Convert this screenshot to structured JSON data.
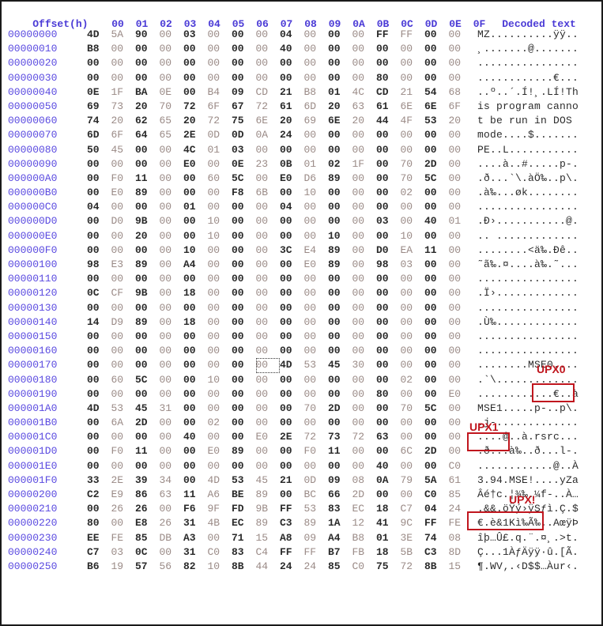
{
  "header": {
    "offset_label": "Offset(h)",
    "columns": [
      "00",
      "01",
      "02",
      "03",
      "04",
      "05",
      "06",
      "07",
      "08",
      "09",
      "0A",
      "0B",
      "0C",
      "0D",
      "0E",
      "0F"
    ],
    "decoded_label": "Decoded text"
  },
  "selected_cell": {
    "row": "00000170",
    "col": "07"
  },
  "rows": [
    {
      "offset": "00000000",
      "bytes": [
        "4D",
        "5A",
        "90",
        "00",
        "03",
        "00",
        "00",
        "00",
        "04",
        "00",
        "00",
        "00",
        "FF",
        "FF",
        "00",
        "00"
      ],
      "text": "MZ..........ÿÿ.."
    },
    {
      "offset": "00000010",
      "bytes": [
        "B8",
        "00",
        "00",
        "00",
        "00",
        "00",
        "00",
        "00",
        "40",
        "00",
        "00",
        "00",
        "00",
        "00",
        "00",
        "00"
      ],
      "text": "¸.......@......."
    },
    {
      "offset": "00000020",
      "bytes": [
        "00",
        "00",
        "00",
        "00",
        "00",
        "00",
        "00",
        "00",
        "00",
        "00",
        "00",
        "00",
        "00",
        "00",
        "00",
        "00"
      ],
      "text": "................"
    },
    {
      "offset": "00000030",
      "bytes": [
        "00",
        "00",
        "00",
        "00",
        "00",
        "00",
        "00",
        "00",
        "00",
        "00",
        "00",
        "00",
        "80",
        "00",
        "00",
        "00"
      ],
      "text": "............€..."
    },
    {
      "offset": "00000040",
      "bytes": [
        "0E",
        "1F",
        "BA",
        "0E",
        "00",
        "B4",
        "09",
        "CD",
        "21",
        "B8",
        "01",
        "4C",
        "CD",
        "21",
        "54",
        "68"
      ],
      "text": "..º..´.Í!¸.LÍ!Th"
    },
    {
      "offset": "00000050",
      "bytes": [
        "69",
        "73",
        "20",
        "70",
        "72",
        "6F",
        "67",
        "72",
        "61",
        "6D",
        "20",
        "63",
        "61",
        "6E",
        "6E",
        "6F"
      ],
      "text": "is program canno"
    },
    {
      "offset": "00000060",
      "bytes": [
        "74",
        "20",
        "62",
        "65",
        "20",
        "72",
        "75",
        "6E",
        "20",
        "69",
        "6E",
        "20",
        "44",
        "4F",
        "53",
        "20"
      ],
      "text": "t be run in DOS "
    },
    {
      "offset": "00000070",
      "bytes": [
        "6D",
        "6F",
        "64",
        "65",
        "2E",
        "0D",
        "0D",
        "0A",
        "24",
        "00",
        "00",
        "00",
        "00",
        "00",
        "00",
        "00"
      ],
      "text": "mode....$......."
    },
    {
      "offset": "00000080",
      "bytes": [
        "50",
        "45",
        "00",
        "00",
        "4C",
        "01",
        "03",
        "00",
        "00",
        "00",
        "00",
        "00",
        "00",
        "00",
        "00",
        "00"
      ],
      "text": "PE..L..........."
    },
    {
      "offset": "00000090",
      "bytes": [
        "00",
        "00",
        "00",
        "00",
        "E0",
        "00",
        "0E",
        "23",
        "0B",
        "01",
        "02",
        "1F",
        "00",
        "70",
        "2D",
        "00"
      ],
      "text": "....à..#.....p-."
    },
    {
      "offset": "000000A0",
      "bytes": [
        "00",
        "F0",
        "11",
        "00",
        "00",
        "60",
        "5C",
        "00",
        "E0",
        "D6",
        "89",
        "00",
        "00",
        "70",
        "5C",
        "00"
      ],
      "text": ".ð...`\\.àÖ‰..p\\."
    },
    {
      "offset": "000000B0",
      "bytes": [
        "00",
        "E0",
        "89",
        "00",
        "00",
        "00",
        "F8",
        "6B",
        "00",
        "10",
        "00",
        "00",
        "00",
        "02",
        "00",
        "00"
      ],
      "text": ".à‰...øk........"
    },
    {
      "offset": "000000C0",
      "bytes": [
        "04",
        "00",
        "00",
        "00",
        "01",
        "00",
        "00",
        "00",
        "04",
        "00",
        "00",
        "00",
        "00",
        "00",
        "00",
        "00"
      ],
      "text": "................"
    },
    {
      "offset": "000000D0",
      "bytes": [
        "00",
        "D0",
        "9B",
        "00",
        "00",
        "10",
        "00",
        "00",
        "00",
        "00",
        "00",
        "00",
        "03",
        "00",
        "40",
        "01"
      ],
      "text": ".Ð›...........@."
    },
    {
      "offset": "000000E0",
      "bytes": [
        "00",
        "00",
        "20",
        "00",
        "00",
        "10",
        "00",
        "00",
        "00",
        "00",
        "10",
        "00",
        "00",
        "10",
        "00",
        "00"
      ],
      "text": ".. ............."
    },
    {
      "offset": "000000F0",
      "bytes": [
        "00",
        "00",
        "00",
        "00",
        "10",
        "00",
        "00",
        "00",
        "3C",
        "E4",
        "89",
        "00",
        "D0",
        "EA",
        "11",
        "00"
      ],
      "text": "........<ä‰.Ðê.."
    },
    {
      "offset": "00000100",
      "bytes": [
        "98",
        "E3",
        "89",
        "00",
        "A4",
        "00",
        "00",
        "00",
        "00",
        "E0",
        "89",
        "00",
        "98",
        "03",
        "00",
        "00"
      ],
      "text": "˜ã‰.¤....à‰.˜..."
    },
    {
      "offset": "00000110",
      "bytes": [
        "00",
        "00",
        "00",
        "00",
        "00",
        "00",
        "00",
        "00",
        "00",
        "00",
        "00",
        "00",
        "00",
        "00",
        "00",
        "00"
      ],
      "text": "................"
    },
    {
      "offset": "00000120",
      "bytes": [
        "0C",
        "CF",
        "9B",
        "00",
        "18",
        "00",
        "00",
        "00",
        "00",
        "00",
        "00",
        "00",
        "00",
        "00",
        "00",
        "00"
      ],
      "text": ".Ï›............."
    },
    {
      "offset": "00000130",
      "bytes": [
        "00",
        "00",
        "00",
        "00",
        "00",
        "00",
        "00",
        "00",
        "00",
        "00",
        "00",
        "00",
        "00",
        "00",
        "00",
        "00"
      ],
      "text": "................"
    },
    {
      "offset": "00000140",
      "bytes": [
        "14",
        "D9",
        "89",
        "00",
        "18",
        "00",
        "00",
        "00",
        "00",
        "00",
        "00",
        "00",
        "00",
        "00",
        "00",
        "00"
      ],
      "text": ".Ù‰............."
    },
    {
      "offset": "00000150",
      "bytes": [
        "00",
        "00",
        "00",
        "00",
        "00",
        "00",
        "00",
        "00",
        "00",
        "00",
        "00",
        "00",
        "00",
        "00",
        "00",
        "00"
      ],
      "text": "................"
    },
    {
      "offset": "00000160",
      "bytes": [
        "00",
        "00",
        "00",
        "00",
        "00",
        "00",
        "00",
        "00",
        "00",
        "00",
        "00",
        "00",
        "00",
        "00",
        "00",
        "00"
      ],
      "text": "................"
    },
    {
      "offset": "00000170",
      "bytes": [
        "00",
        "00",
        "00",
        "00",
        "00",
        "00",
        "00",
        "00",
        "4D",
        "53",
        "45",
        "30",
        "00",
        "00",
        "00",
        "00"
      ],
      "text": "........MSE0...."
    },
    {
      "offset": "00000180",
      "bytes": [
        "00",
        "60",
        "5C",
        "00",
        "00",
        "10",
        "00",
        "00",
        "00",
        "00",
        "00",
        "00",
        "00",
        "02",
        "00",
        "00"
      ],
      "text": ".`\\............."
    },
    {
      "offset": "00000190",
      "bytes": [
        "00",
        "00",
        "00",
        "00",
        "00",
        "00",
        "00",
        "00",
        "00",
        "00",
        "00",
        "00",
        "80",
        "00",
        "00",
        "E0"
      ],
      "text": "............€..à"
    },
    {
      "offset": "000001A0",
      "bytes": [
        "4D",
        "53",
        "45",
        "31",
        "00",
        "00",
        "00",
        "00",
        "00",
        "70",
        "2D",
        "00",
        "00",
        "70",
        "5C",
        "00"
      ],
      "text": "MSE1.....p-..p\\."
    },
    {
      "offset": "000001B0",
      "bytes": [
        "00",
        "6A",
        "2D",
        "00",
        "00",
        "02",
        "00",
        "00",
        "00",
        "00",
        "00",
        "00",
        "00",
        "00",
        "00",
        "00"
      ],
      "text": ".j-............."
    },
    {
      "offset": "000001C0",
      "bytes": [
        "00",
        "00",
        "00",
        "00",
        "40",
        "00",
        "00",
        "E0",
        "2E",
        "72",
        "73",
        "72",
        "63",
        "00",
        "00",
        "00"
      ],
      "text": "....@..à.rsrc..."
    },
    {
      "offset": "000001D0",
      "bytes": [
        "00",
        "F0",
        "11",
        "00",
        "00",
        "E0",
        "89",
        "00",
        "00",
        "F0",
        "11",
        "00",
        "00",
        "6C",
        "2D",
        "00"
      ],
      "text": ".ð...à‰..ð...l-."
    },
    {
      "offset": "000001E0",
      "bytes": [
        "00",
        "00",
        "00",
        "00",
        "00",
        "00",
        "00",
        "00",
        "00",
        "00",
        "00",
        "00",
        "40",
        "00",
        "00",
        "C0"
      ],
      "text": "............@..À"
    },
    {
      "offset": "000001F0",
      "bytes": [
        "33",
        "2E",
        "39",
        "34",
        "00",
        "4D",
        "53",
        "45",
        "21",
        "0D",
        "09",
        "08",
        "0A",
        "79",
        "5A",
        "61"
      ],
      "text": "3.94.MSE!....yZa"
    },
    {
      "offset": "00000200",
      "bytes": [
        "C2",
        "E9",
        "86",
        "63",
        "11",
        "A6",
        "BE",
        "89",
        "00",
        "BC",
        "66",
        "2D",
        "00",
        "00",
        "C0",
        "85"
      ],
      "text": "Âé†c.¦¾‰.¼f-..À…"
    },
    {
      "offset": "00000210",
      "bytes": [
        "00",
        "26",
        "26",
        "00",
        "F6",
        "9F",
        "FD",
        "9B",
        "FF",
        "53",
        "83",
        "EC",
        "18",
        "C7",
        "04",
        "24"
      ],
      "text": ".&&.öŸý›ÿSƒì.Ç.$"
    },
    {
      "offset": "00000220",
      "bytes": [
        "80",
        "00",
        "E8",
        "26",
        "31",
        "4B",
        "EC",
        "89",
        "C3",
        "89",
        "1A",
        "12",
        "41",
        "9C",
        "FF",
        "FE"
      ],
      "text": "€.è&1Kì‰Ã‰..AœÿÞ"
    },
    {
      "offset": "00000230",
      "bytes": [
        "EE",
        "FE",
        "85",
        "DB",
        "A3",
        "00",
        "71",
        "15",
        "A8",
        "09",
        "A4",
        "B8",
        "01",
        "3E",
        "74",
        "08"
      ],
      "text": "îþ…Û£.q.¨.¤¸.>t."
    },
    {
      "offset": "00000240",
      "bytes": [
        "C7",
        "03",
        "0C",
        "00",
        "31",
        "C0",
        "83",
        "C4",
        "FF",
        "FF",
        "B7",
        "FB",
        "18",
        "5B",
        "C3",
        "8D"
      ],
      "text": "Ç...1ÀƒÄÿÿ·û.[Ã."
    },
    {
      "offset": "00000250",
      "bytes": [
        "B6",
        "19",
        "57",
        "56",
        "82",
        "10",
        "8B",
        "44",
        "24",
        "24",
        "85",
        "C0",
        "75",
        "72",
        "8B",
        "15"
      ],
      "text": "¶.WV‚.‹D$$…Àur‹."
    }
  ],
  "annotations": [
    {
      "label": "UPX0",
      "boxed_text": "MSE0"
    },
    {
      "label": "UPX1",
      "boxed_text": "MSE1"
    },
    {
      "label": "UPX!",
      "boxed_text": "3.94.MSE!"
    }
  ],
  "colors": {
    "offset": "#5a4ae0",
    "header": "#4a3ad6",
    "annotation": "#c0161e"
  }
}
